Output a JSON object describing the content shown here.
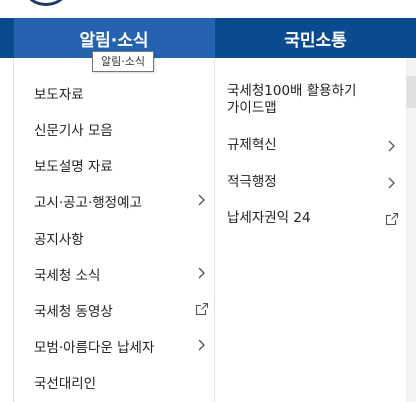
{
  "nav": {
    "tabs": [
      {
        "label": "알림·소식"
      },
      {
        "label": "국민소통"
      }
    ],
    "tooltip": "알림·소식"
  },
  "menu": {
    "col1": [
      {
        "label": "보도자료",
        "icon": "none"
      },
      {
        "label": "신문기사 모음",
        "icon": "none"
      },
      {
        "label": "보도설명 자료",
        "icon": "none"
      },
      {
        "label": "고시·공고·행정예고",
        "icon": "chevron-right-icon"
      },
      {
        "label": "공지사항",
        "icon": "none"
      },
      {
        "label": "국세청 소식",
        "icon": "chevron-right-icon"
      },
      {
        "label": "국세청 동영상",
        "icon": "external-link-icon"
      },
      {
        "label": "모범·아름다운 납세자",
        "icon": "chevron-right-icon"
      },
      {
        "label": "국선대리인",
        "icon": "none"
      }
    ],
    "col2": [
      {
        "label_line1": "국세청100배 활용하기",
        "label_line2": "가이드맵",
        "icon": "none"
      },
      {
        "label_line1": "규제혁신",
        "icon": "chevron-right-icon"
      },
      {
        "label_line1": "적극행정",
        "icon": "chevron-right-icon"
      },
      {
        "label_line1": "납세자권익 24",
        "icon": "external-link-icon"
      }
    ]
  },
  "colors": {
    "nav_bg": "#0a4a8f",
    "nav_active": "#2563b0",
    "text": "#222222"
  }
}
